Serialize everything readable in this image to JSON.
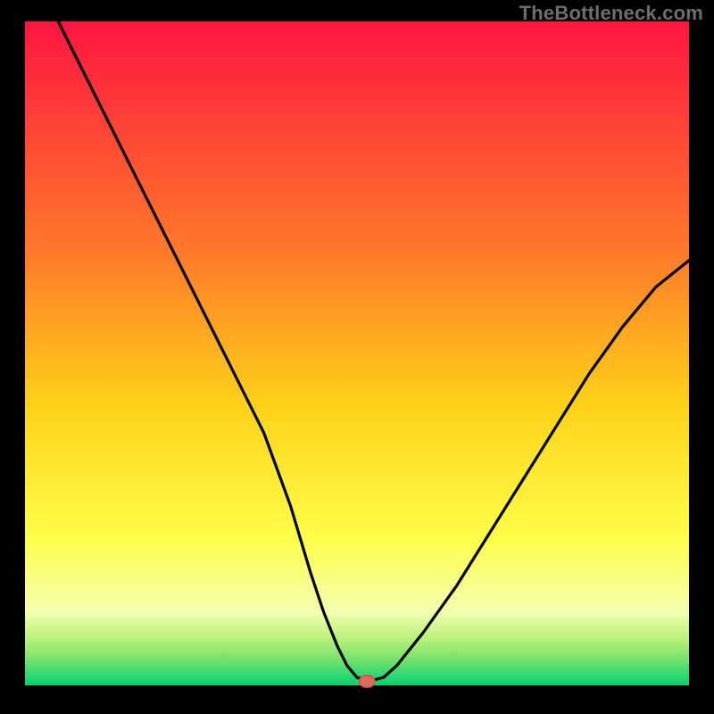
{
  "watermark": "TheBottleneck.com",
  "colors": {
    "frame": "#000000",
    "curve": "#000000",
    "marker_fill": "#e06a5a",
    "marker_stroke": "#c95545",
    "gradient": {
      "top": "#ff1540",
      "mid1": "#ff7a2a",
      "mid2": "#ffd21a",
      "mid3": "#ffff4a",
      "pale": "#f3ffb0",
      "green1": "#b7f27a",
      "green2": "#78e26a",
      "green3": "#2ed873",
      "green4": "#08d16b"
    }
  },
  "chart_data": {
    "type": "line",
    "title": "",
    "xlabel": "",
    "ylabel": "",
    "xlim": [
      0,
      100
    ],
    "ylim": [
      0,
      100
    ],
    "grid": false,
    "legend": false,
    "series": [
      {
        "name": "curve",
        "x": [
          5,
          8,
          12,
          16,
          20,
          24,
          28,
          32,
          36,
          40,
          43,
          45,
          47,
          48.5,
          50,
          52,
          54,
          56,
          60,
          65,
          70,
          75,
          80,
          85,
          90,
          95,
          100
        ],
        "y": [
          100,
          94,
          86,
          78,
          70,
          62,
          54,
          46,
          38,
          27,
          17,
          11,
          6,
          3,
          1.2,
          0.7,
          1.2,
          3,
          8,
          15,
          23,
          31,
          39,
          47,
          54,
          60,
          64
        ]
      }
    ],
    "marker": {
      "x": 51.5,
      "y": 0.6,
      "rx": 1.2,
      "ry": 0.9
    }
  }
}
